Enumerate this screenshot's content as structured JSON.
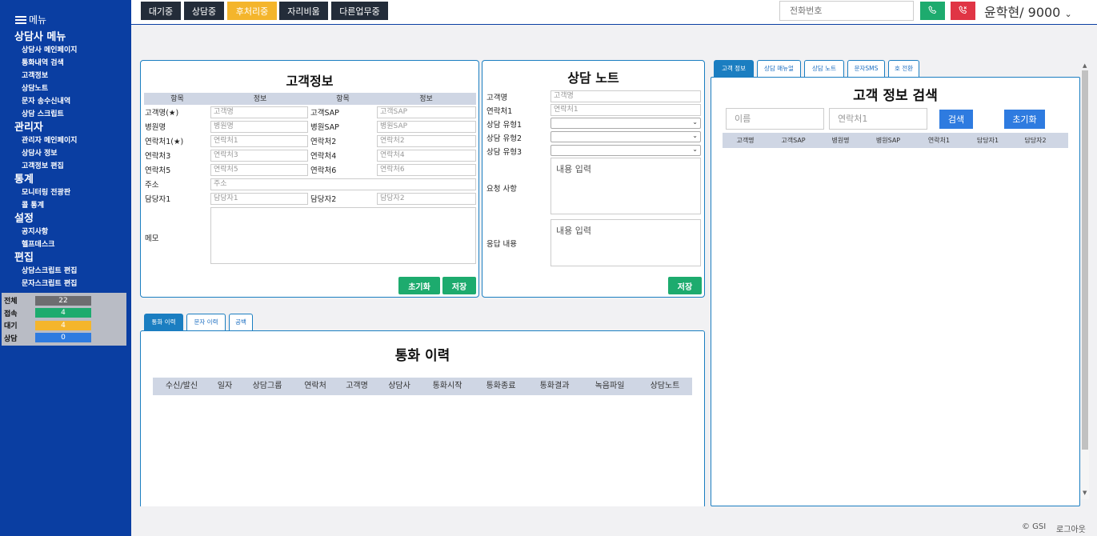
{
  "sidebar": {
    "menu_label": "메뉴",
    "groups": [
      {
        "header": "상담사 메뉴",
        "items": [
          "상담사 메인페이지",
          "통화내역 검색",
          "고객정보",
          "상담노트",
          "문자 송수신내역",
          "상담 스크립트"
        ]
      },
      {
        "header": "관리자",
        "items": [
          "관리자 메인페이지",
          "상담사 정보",
          "고객정보 편집"
        ]
      },
      {
        "header": "통계",
        "items": [
          "모니터링 전광판",
          "콜 통계"
        ]
      },
      {
        "header": "설정",
        "items": [
          "공지사항",
          "헬프데스크"
        ]
      },
      {
        "header": "편집",
        "items": [
          "상담스크립트 편집",
          "문자스크립트 편집"
        ]
      }
    ],
    "stats": [
      {
        "label": "전체",
        "value": "22",
        "color": "#6d6d70"
      },
      {
        "label": "접속",
        "value": "4",
        "color": "#1dab6e"
      },
      {
        "label": "대기",
        "value": "4",
        "color": "#f4b52c"
      },
      {
        "label": "상담",
        "value": "0",
        "color": "#2e7be0"
      }
    ]
  },
  "topbar": {
    "status_buttons": [
      {
        "label": "대기중",
        "color": "#232c39"
      },
      {
        "label": "상담중",
        "color": "#232c39"
      },
      {
        "label": "후처리중",
        "color": "#f4b52c"
      },
      {
        "label": "자리비움",
        "color": "#232c39"
      },
      {
        "label": "다른업무중",
        "color": "#232c39"
      }
    ],
    "phone_placeholder": "전화번호",
    "call_color": "#1dab6e",
    "hangup_color": "#e03545",
    "user": "윤학현/ 9000",
    "user_chevron": "⌄"
  },
  "customer_info": {
    "title": "고객정보",
    "header": [
      "항목",
      "정보",
      "항목",
      "정보"
    ],
    "rows": [
      {
        "l1": "고객명(★)",
        "p1": "고객명",
        "l2": "고객SAP",
        "p2": "고객SAP"
      },
      {
        "l1": "병원명",
        "p1": "병원명",
        "l2": "병원SAP",
        "p2": "병원SAP"
      },
      {
        "l1": "연락처1(★)",
        "p1": "연락처1",
        "l2": "연락처2",
        "p2": "연락처2"
      },
      {
        "l1": "연락처3",
        "p1": "연락처3",
        "l2": "연락처4",
        "p2": "연락처4"
      },
      {
        "l1": "연락처5",
        "p1": "연락처5",
        "l2": "연락처6",
        "p2": "연락처6"
      }
    ],
    "address_label": "주소",
    "address_placeholder": "주소",
    "manager1_label": "담당자1",
    "manager1_placeholder": "담당자1",
    "manager2_label": "담당자2",
    "manager2_placeholder": "담당자2",
    "memo_label": "메모",
    "reset_label": "초기화",
    "save_label": "저장"
  },
  "consult_note": {
    "title": "상담 노트",
    "name_label": "고객명",
    "name_placeholder": "고객명",
    "contact_label": "연락처1",
    "contact_placeholder": "연락처1",
    "type1_label": "상담 유형1",
    "type2_label": "상담 유형2",
    "type3_label": "상담 유형3",
    "request_label": "요청 사항",
    "request_placeholder": "내용 입력",
    "response_label": "응답 내용",
    "response_placeholder": "내용 입력",
    "save_label": "저장"
  },
  "history": {
    "tabs": [
      "통화 이력",
      "문자 이력",
      "공백"
    ],
    "title": "통화 이력",
    "columns": [
      "수신/발신",
      "일자",
      "상담그룹",
      "연락처",
      "고객명",
      "상담사",
      "통화시작",
      "통화종료",
      "통화결과",
      "녹음파일",
      "상담노트"
    ]
  },
  "right_panel": {
    "tabs": [
      "고객 정보",
      "상담 매뉴얼",
      "상담 노트",
      "문자SMS",
      "호 전환"
    ],
    "title": "고객 정보 검색",
    "name_placeholder": "이름",
    "contact_placeholder": "연락처1",
    "search_label": "검색",
    "reset_label": "초기화",
    "columns": [
      "고객명",
      "고객SAP",
      "병원명",
      "병원SAP",
      "연락처1",
      "담당자1",
      "담당자2"
    ]
  },
  "footer": {
    "copyright": "© GSI",
    "logout": "로그아웃"
  }
}
